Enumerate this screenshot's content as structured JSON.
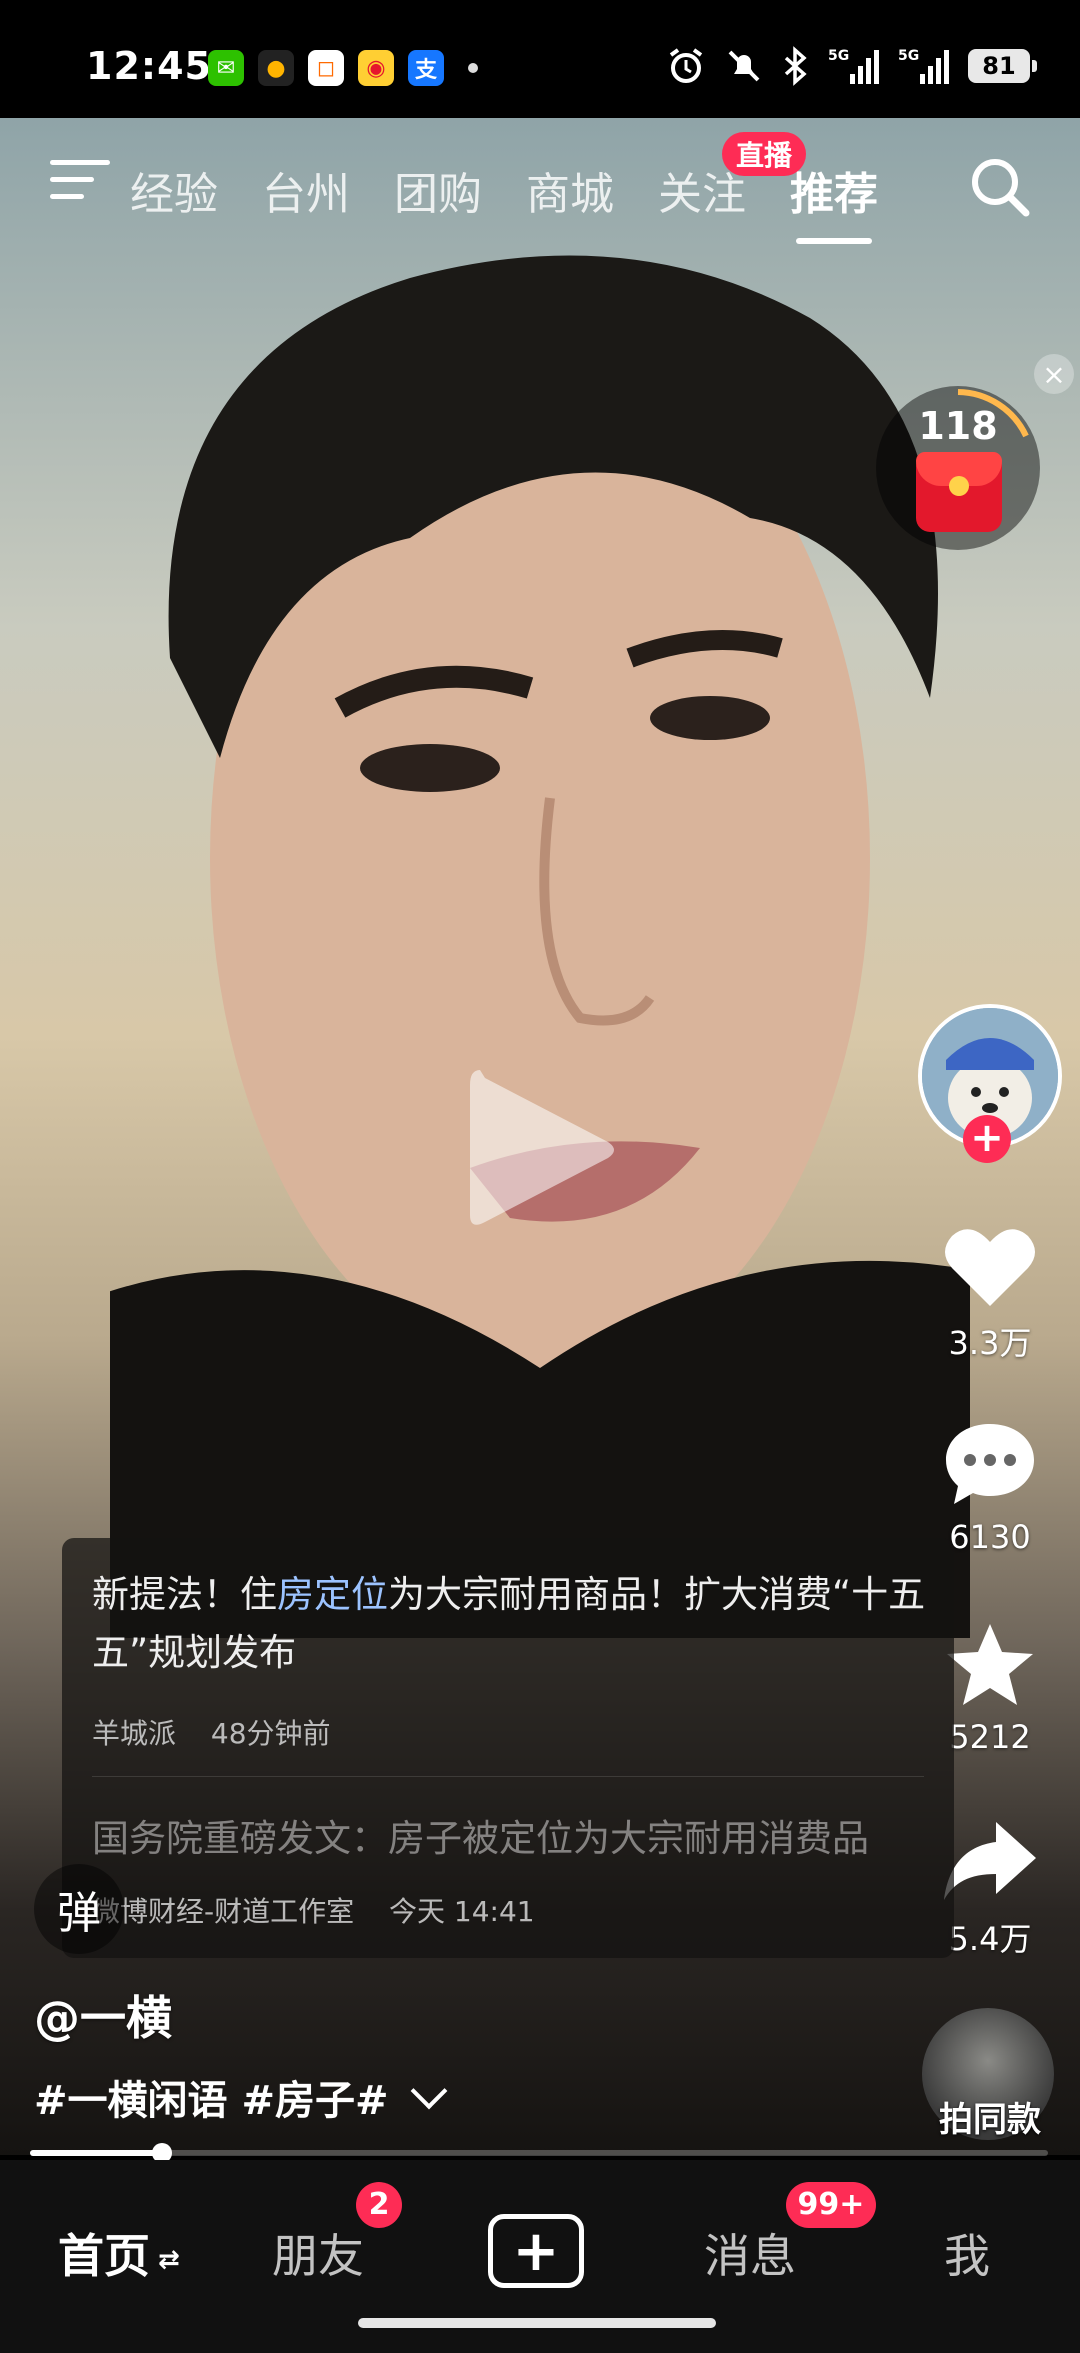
{
  "status_bar": {
    "time": "12:45",
    "apps": [
      {
        "icon": "wechat-icon",
        "glyph": "✉",
        "color": "#2dc100"
      },
      {
        "icon": "drop-app-icon",
        "glyph": "●",
        "color": "#ffb400"
      },
      {
        "icon": "bag-app-icon",
        "glyph": "◻",
        "color": "#ff6a00"
      },
      {
        "icon": "weibo-icon",
        "glyph": "◉",
        "color": "#e6162d"
      },
      {
        "icon": "alipay-icon",
        "glyph": "支",
        "color": "#1677ff"
      }
    ],
    "signal_1": "5G",
    "signal_2": "5G",
    "battery": "81"
  },
  "top_nav": {
    "tabs": [
      "经验",
      "台州",
      "团购",
      "商城",
      "关注",
      "推荐"
    ],
    "active_tab": "推荐",
    "live_badge": "直播"
  },
  "red_packet": {
    "count": "118"
  },
  "right_rail": {
    "likes": "3.3万",
    "comments": "6130",
    "favorites": "5212",
    "shares": "5.4万",
    "follow_label": "+"
  },
  "news_card": {
    "title_before": "新提法！住",
    "title_highlight": "房定位",
    "title_after": "为大宗耐用商品！扩大消费“十五五”规划发布",
    "source": "羊城派",
    "time": "48分钟前",
    "second_title": "国务院重磅发文：房子被定位为大宗耐用消费品",
    "second_source": "微博财经-财道工作室",
    "second_time": "今天 14:41"
  },
  "danmu_label": "弹",
  "author": "@一横",
  "caption": "#一横闲语 #房子#",
  "same_style_label": "拍同款",
  "progress": 0.13,
  "bottom_nav": {
    "home": "首页",
    "friends": "朋友",
    "friends_badge": "2",
    "create": "+",
    "messages": "消息",
    "messages_badge": "99+",
    "me": "我"
  }
}
